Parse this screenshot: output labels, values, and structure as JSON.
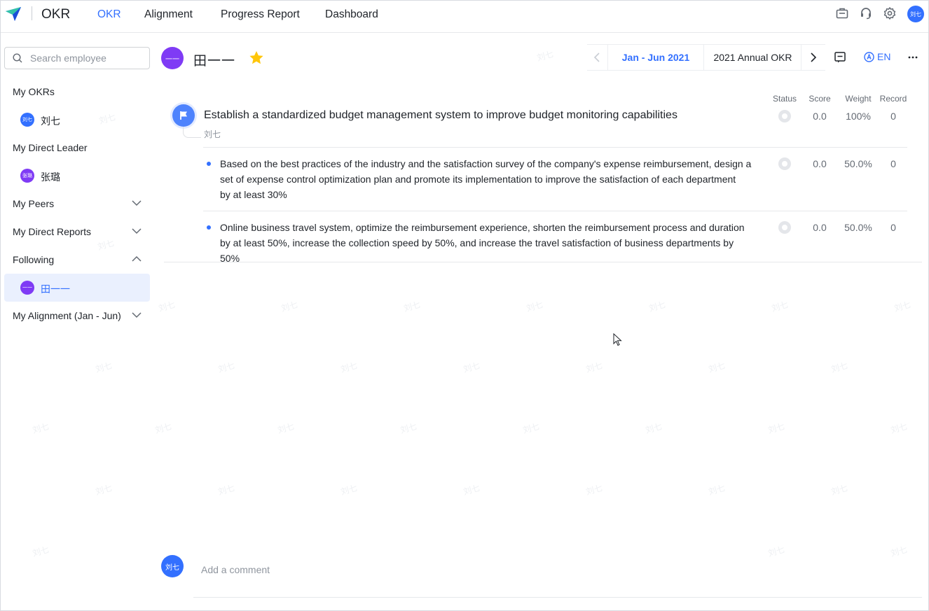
{
  "app": {
    "title": "OKR",
    "brand_color": "#3370ff"
  },
  "nav": {
    "items": [
      {
        "label": "OKR",
        "active": true
      },
      {
        "label": "Alignment",
        "active": false
      },
      {
        "label": "Progress Report",
        "active": false
      },
      {
        "label": "Dashboard",
        "active": false
      }
    ],
    "icons": [
      "briefcase-icon",
      "headset-icon",
      "gear-icon"
    ],
    "user_avatar": "刘七"
  },
  "sidebar": {
    "search_placeholder": "Search employee",
    "sections": {
      "my_okrs": "My OKRs",
      "my_okrs_person": {
        "name": "刘七",
        "avatar": "刘七",
        "color": "#3370ff"
      },
      "direct_leader": "My Direct Leader",
      "direct_leader_person": {
        "name": "张璐",
        "avatar": "张璐",
        "color": "#7f3bf5"
      },
      "peers": "My Peers",
      "direct_reports": "My Direct Reports",
      "following": "Following",
      "following_person": {
        "name": "田一一",
        "avatar": "一一",
        "color": "#7f3bf5"
      },
      "alignment": "My Alignment (Jan - Jun)"
    }
  },
  "header": {
    "owner_avatar": "一一",
    "owner_name": "田一一",
    "starred": true,
    "period_current": "Jan - Jun 2021",
    "period_other": "2021 Annual OKR",
    "language": "EN"
  },
  "table": {
    "columns": {
      "status": "Status",
      "score": "Score",
      "weight": "Weight",
      "record": "Record"
    },
    "objective": {
      "title": "Establish a standardized budget management system to improve budget monitoring capabilities",
      "owner": "刘七",
      "score": "0.0",
      "weight": "100%",
      "record": "0"
    },
    "key_results": [
      {
        "line1": "Based on the best practices of the industry and the satisfaction survey of the company's expense reimbursement, design a",
        "line2": "set of expense control optimization plan and promote its implementation to improve the satisfaction of each department",
        "line3": "by at least 30%",
        "score": "0.0",
        "weight": "50.0%",
        "record": "0"
      },
      {
        "line1": "Online business travel system, optimize the reimbursement experience, shorten the reimbursement process and duration",
        "line2": "by at least 50%, increase the collection speed by 50%, and increase the travel satisfaction of business departments by 50%",
        "score": "0.0",
        "weight": "50.0%",
        "record": "0"
      }
    ]
  },
  "comment": {
    "avatar": "刘七",
    "placeholder": "Add a comment"
  },
  "watermark": "刘七"
}
